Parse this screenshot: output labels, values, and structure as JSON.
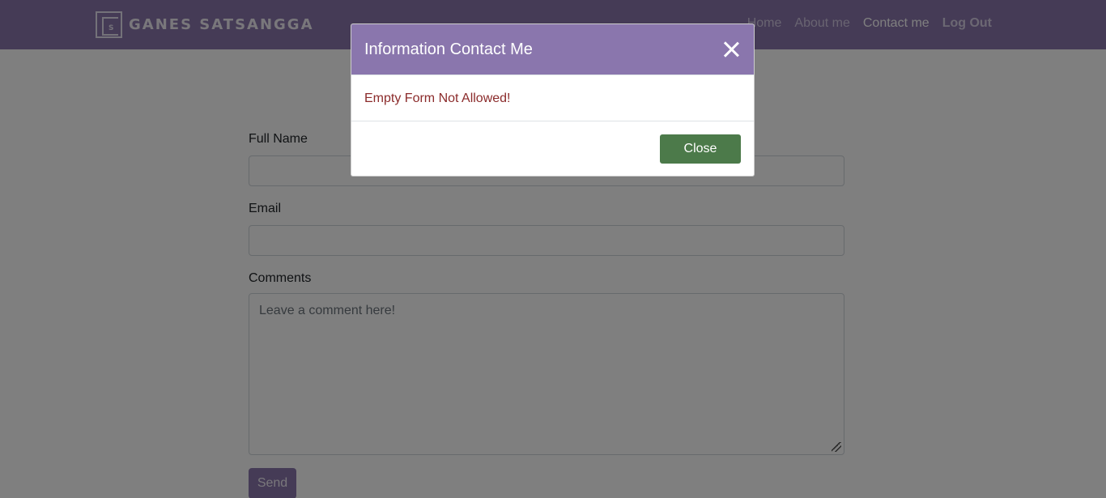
{
  "navbar": {
    "brand_name": "GANES SATSANGGA",
    "links": [
      {
        "label": "Home"
      },
      {
        "label": "About me"
      },
      {
        "label": "Contact me"
      },
      {
        "label": "Log Out"
      }
    ]
  },
  "form": {
    "full_name_label": "Full Name",
    "full_name_value": "",
    "email_label": "Email",
    "email_value": "",
    "comments_label": "Comments",
    "comments_placeholder": "Leave a comment here!",
    "send_label": "Send"
  },
  "modal": {
    "title": "Information Contact Me",
    "message": "Empty Form Not Allowed!",
    "close_label": "Close"
  },
  "colors": {
    "brand": "#8a76ad",
    "error_text": "#8b2b2b",
    "close_button": "#4c7a4a"
  }
}
